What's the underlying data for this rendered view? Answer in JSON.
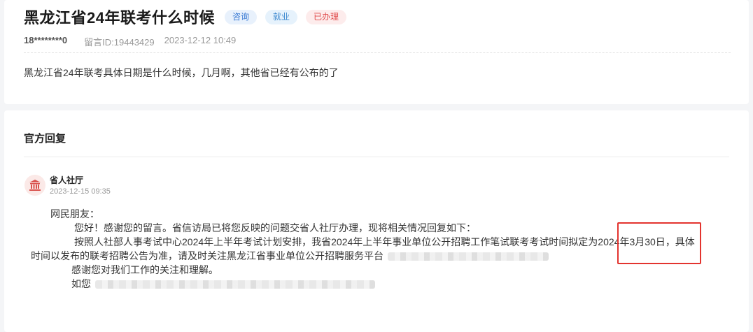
{
  "question": {
    "title": "黑龙江省24年联考什么时候",
    "tags": [
      {
        "label": "咨询"
      },
      {
        "label": "就业"
      },
      {
        "label": "已办理"
      }
    ],
    "user": "18********0",
    "message_id": "留言ID:19443429",
    "datetime": "2023-12-12 10:49",
    "body": "黑龙江省24年联考具体日期是什么时候，几月啊，其他省已经有公布的了"
  },
  "reply": {
    "heading": "官方回复",
    "org": "省人社厅",
    "datetime": "2023-12-15 09:35",
    "avatar_icon": "government-building-icon",
    "greeting": "网民朋友：",
    "para1": "您好！感谢您的留言。省信访局已将您反映的问题交省人社厅办理，现将相关情况回复如下：",
    "para2_a": "按照人社部人事考试中心2024年上半年考试计划安排，我省2024年上半年事业单位公开招聘工作笔试联考考试时间拟定为",
    "para2_date": "2024年3月30日",
    "para2_b": "，具体",
    "para2_c": "时间以发布的联考招聘公告为准，请及时关注黑龙江省事业单位公开招聘服务平台",
    "para3": "感谢您对我们工作的关注和理解。",
    "para4": "如您",
    "highlight_color": "#e3342f"
  }
}
